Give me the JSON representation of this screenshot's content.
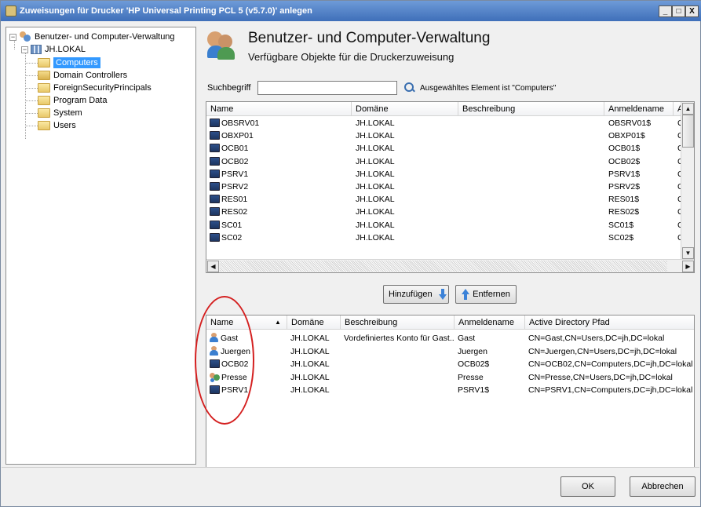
{
  "window": {
    "title": "Zuweisungen für Drucker 'HP Universal Printing PCL 5 (v5.7.0)' anlegen",
    "buttons": [
      "_",
      "□",
      "X"
    ]
  },
  "tree": {
    "root": "Benutzer- und Computer-Verwaltung",
    "domain": "JH.LOKAL",
    "items": [
      "Computers",
      "Domain Controllers",
      "ForeignSecurityPrincipals",
      "Program Data",
      "System",
      "Users"
    ],
    "selected": "Computers",
    "expander_minus": "−"
  },
  "header": {
    "title": "Benutzer- und Computer-Verwaltung",
    "subtitle": "Verfügbare Objekte für die Druckerzuweisung"
  },
  "search": {
    "label": "Suchbegriff",
    "value": "",
    "status": "Ausgewähltes Element ist \"Computers\""
  },
  "available": {
    "columns": [
      "Name",
      "Domäne",
      "Beschreibung",
      "Anmeldename",
      "Act"
    ],
    "rows": [
      {
        "name": "OBSRV01",
        "domain": "JH.LOKAL",
        "desc": "",
        "login": "OBSRV01$",
        "ad": "CN"
      },
      {
        "name": "OBXP01",
        "domain": "JH.LOKAL",
        "desc": "",
        "login": "OBXP01$",
        "ad": "CN"
      },
      {
        "name": "OCB01",
        "domain": "JH.LOKAL",
        "desc": "",
        "login": "OCB01$",
        "ad": "CN"
      },
      {
        "name": "OCB02",
        "domain": "JH.LOKAL",
        "desc": "",
        "login": "OCB02$",
        "ad": "CN"
      },
      {
        "name": "PSRV1",
        "domain": "JH.LOKAL",
        "desc": "",
        "login": "PSRV1$",
        "ad": "CN"
      },
      {
        "name": "PSRV2",
        "domain": "JH.LOKAL",
        "desc": "",
        "login": "PSRV2$",
        "ad": "CN"
      },
      {
        "name": "RES01",
        "domain": "JH.LOKAL",
        "desc": "",
        "login": "RES01$",
        "ad": "CN"
      },
      {
        "name": "RES02",
        "domain": "JH.LOKAL",
        "desc": "",
        "login": "RES02$",
        "ad": "CN"
      },
      {
        "name": "SC01",
        "domain": "JH.LOKAL",
        "desc": "",
        "login": "SC01$",
        "ad": "CN"
      },
      {
        "name": "SC02",
        "domain": "JH.LOKAL",
        "desc": "",
        "login": "SC02$",
        "ad": "CN"
      }
    ]
  },
  "actions": {
    "add": "Hinzufügen",
    "remove": "Entfernen"
  },
  "assigned": {
    "columns": [
      "Name",
      "Domäne",
      "Beschreibung",
      "Anmeldename",
      "Active Directory Pfad"
    ],
    "sort_indicator": "▲",
    "rows": [
      {
        "name": "Gast",
        "type": "user",
        "domain": "JH.LOKAL",
        "desc": "Vordefiniertes Konto für Gast..",
        "login": "Gast",
        "ad": "CN=Gast,CN=Users,DC=jh,DC=lokal"
      },
      {
        "name": "Juergen",
        "type": "user",
        "domain": "JH.LOKAL",
        "desc": "",
        "login": "Juergen",
        "ad": "CN=Juergen,CN=Users,DC=jh,DC=lokal"
      },
      {
        "name": "OCB02",
        "type": "computer",
        "domain": "JH.LOKAL",
        "desc": "",
        "login": "OCB02$",
        "ad": "CN=OCB02,CN=Computers,DC=jh,DC=lokal"
      },
      {
        "name": "Presse",
        "type": "group",
        "domain": "JH.LOKAL",
        "desc": "",
        "login": "Presse",
        "ad": "CN=Presse,CN=Users,DC=jh,DC=lokal"
      },
      {
        "name": "PSRV1",
        "type": "computer",
        "domain": "JH.LOKAL",
        "desc": "",
        "login": "PSRV1$",
        "ad": "CN=PSRV1,CN=Computers,DC=jh,DC=lokal"
      }
    ]
  },
  "scroll": {
    "left": "◀",
    "right": "▶",
    "up": "▲",
    "down": "▼"
  },
  "footer": {
    "ok": "OK",
    "cancel": "Abbrechen"
  },
  "colors": {
    "selection": "#3399ff",
    "annotation": "#d42020",
    "titlebar": "#3f6fb9"
  }
}
